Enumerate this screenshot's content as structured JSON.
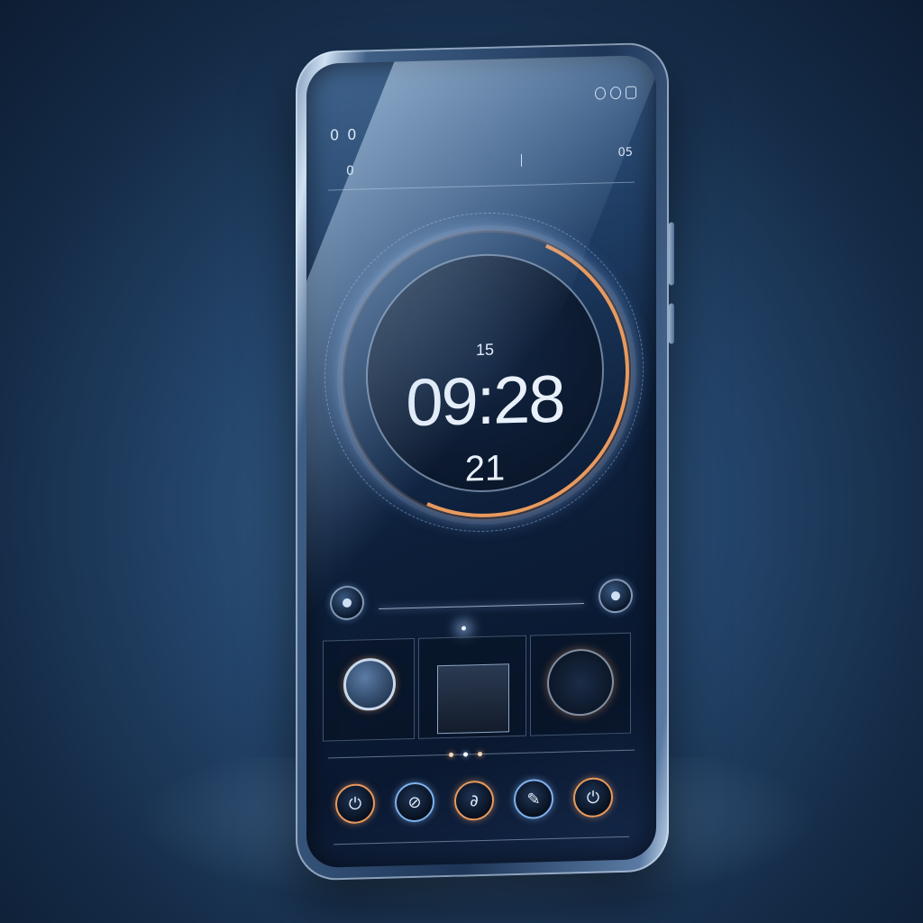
{
  "status_bar": {
    "top_left": "0 0",
    "second_left": "0",
    "right_value": "05",
    "subtitle": "",
    "icons": [
      "ring-icon",
      "ring-icon",
      "battery-icon"
    ]
  },
  "clock": {
    "date_label": "",
    "seconds_label": "15",
    "time": "09:28",
    "day_label": "21",
    "bottom_label": ""
  },
  "dock": {
    "buttons": [
      "power-icon",
      "lock-icon",
      "link-icon",
      "pen-icon",
      "power-icon"
    ]
  },
  "colors": {
    "accent_orange": "#e89a5e",
    "accent_blue": "#7fb2ee",
    "screen_dark": "#0a1830",
    "background": "#24456b"
  }
}
